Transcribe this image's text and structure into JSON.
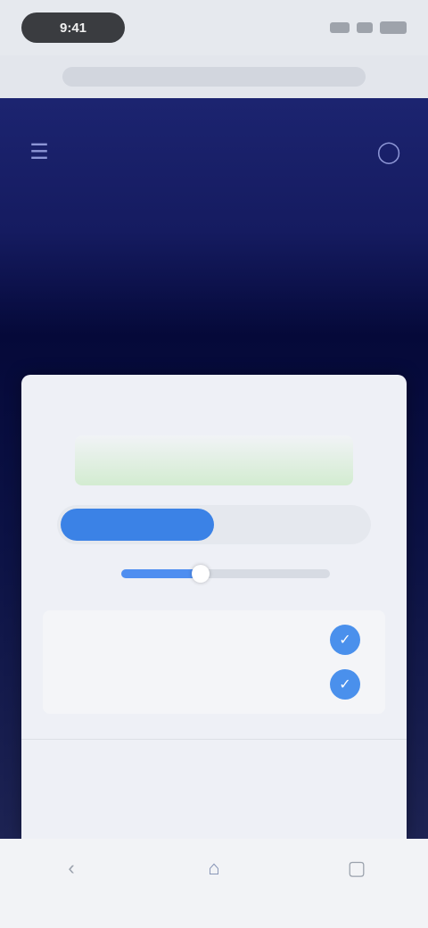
{
  "status_bar": {
    "time": "9:41"
  },
  "browser": {
    "url": ""
  },
  "hero": {
    "title": "",
    "left_icon": "menu-icon",
    "right_icon": "user-icon"
  },
  "card": {
    "top_left": "",
    "top_right": "",
    "banner_text": "",
    "segments": [
      {
        "label": "",
        "active": true
      },
      {
        "label": "",
        "active": false
      }
    ],
    "progress": {
      "label": "",
      "fraction": 0.38,
      "value_text": ""
    },
    "section_label": "",
    "options": [
      {
        "label": "",
        "icon": "check-icon"
      },
      {
        "label": "",
        "icon": "check-icon"
      }
    ],
    "button_label": ""
  },
  "colors": {
    "hero_top": "#1c2470",
    "hero_dark": "#050939",
    "accent_blue": "#3b82e6",
    "banner_green": "#d3ecd1"
  },
  "bottom_bar": {
    "icons": [
      "back-icon",
      "home-icon",
      "tabs-icon"
    ]
  }
}
